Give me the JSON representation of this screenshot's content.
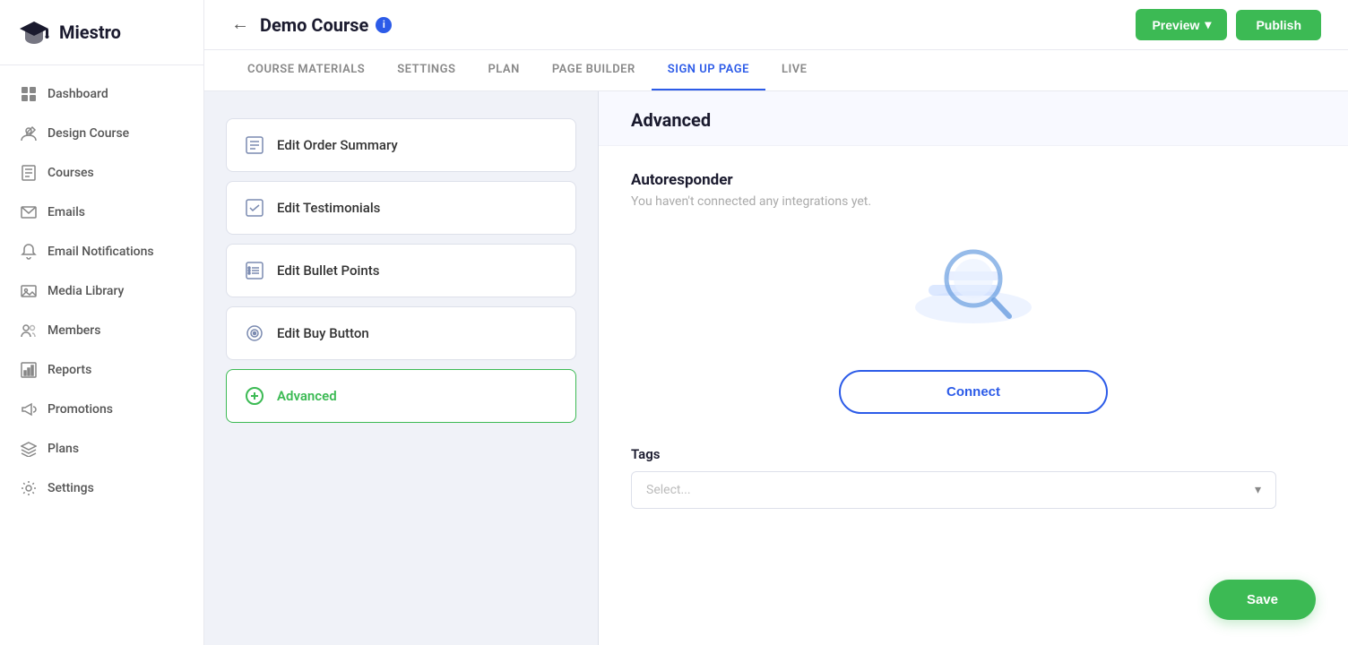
{
  "app": {
    "logo_text": "Miestro",
    "page_title": "Demo Course"
  },
  "sidebar": {
    "items": [
      {
        "id": "dashboard",
        "label": "Dashboard",
        "icon": "grid"
      },
      {
        "id": "design-course",
        "label": "Design Course",
        "icon": "edit-design"
      },
      {
        "id": "courses",
        "label": "Courses",
        "icon": "book"
      },
      {
        "id": "emails",
        "label": "Emails",
        "icon": "email"
      },
      {
        "id": "email-notifications",
        "label": "Email Notifications",
        "icon": "bell"
      },
      {
        "id": "media-library",
        "label": "Media Library",
        "icon": "image"
      },
      {
        "id": "members",
        "label": "Members",
        "icon": "users"
      },
      {
        "id": "reports",
        "label": "Reports",
        "icon": "chart"
      },
      {
        "id": "promotions",
        "label": "Promotions",
        "icon": "megaphone"
      },
      {
        "id": "plans",
        "label": "Plans",
        "icon": "layers"
      },
      {
        "id": "settings",
        "label": "Settings",
        "icon": "gear"
      }
    ]
  },
  "topbar": {
    "back_label": "←",
    "preview_label": "Preview",
    "publish_label": "Publish"
  },
  "tabs": [
    {
      "id": "course-materials",
      "label": "COURSE MATERIALS"
    },
    {
      "id": "settings",
      "label": "SETTINGS"
    },
    {
      "id": "plan",
      "label": "PLAN"
    },
    {
      "id": "page-builder",
      "label": "PAGE BUILDER"
    },
    {
      "id": "sign-up-page",
      "label": "SIGN UP PAGE",
      "active": true
    },
    {
      "id": "live",
      "label": "LIVE"
    }
  ],
  "left_panel": {
    "cards": [
      {
        "id": "order-summary",
        "label": "Edit Order Summary",
        "icon": "list"
      },
      {
        "id": "testimonials",
        "label": "Edit Testimonials",
        "icon": "check-square"
      },
      {
        "id": "bullet-points",
        "label": "Edit Bullet Points",
        "icon": "bullet-list"
      },
      {
        "id": "buy-button",
        "label": "Edit Buy Button",
        "icon": "target"
      },
      {
        "id": "advanced",
        "label": "Advanced",
        "icon": "plus-circle",
        "active": true
      }
    ]
  },
  "right_panel": {
    "section_title": "Advanced",
    "autoresponder_title": "Autoresponder",
    "autoresponder_subtitle": "You haven't connected any integrations yet.",
    "connect_button_label": "Connect",
    "tags_label": "Tags",
    "tags_placeholder": "Select...",
    "save_button_label": "Save"
  }
}
